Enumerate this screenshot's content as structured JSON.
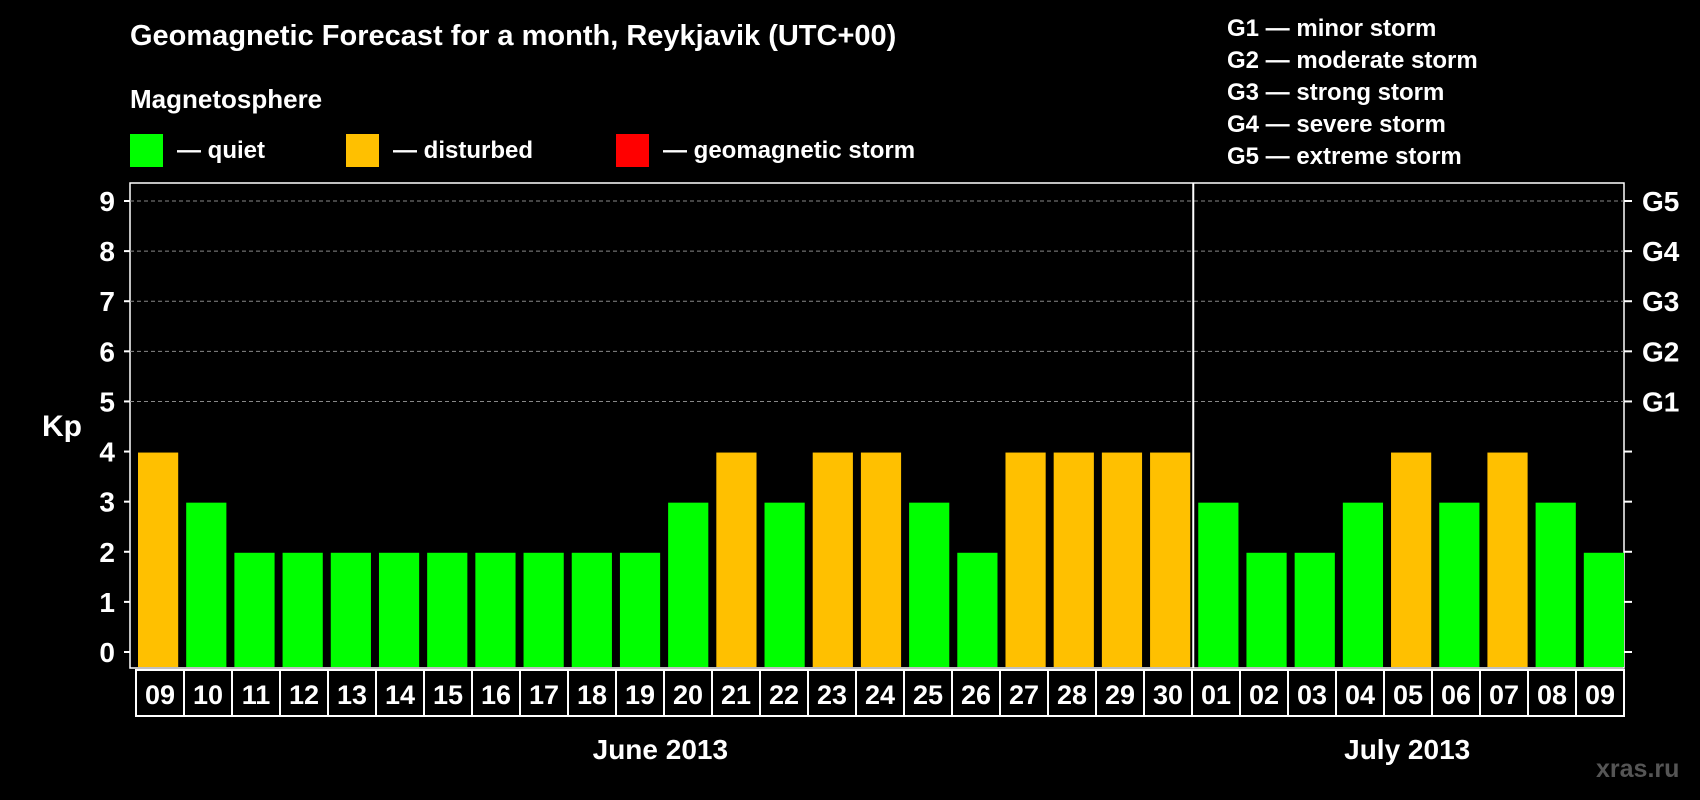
{
  "title": "Geomagnetic Forecast for a month, Reykjavik (UTC+00)",
  "magnetosphere_label": "Magnetosphere",
  "legend": [
    {
      "label": "— quiet",
      "color": "#00ff00"
    },
    {
      "label": "— disturbed",
      "color": "#ffc000"
    },
    {
      "label": "— geomagnetic storm",
      "color": "#ff0000"
    }
  ],
  "storm_levels": [
    "G1 — minor storm",
    "G2 — moderate storm",
    "G3 — strong storm",
    "G4 — severe storm",
    "G5 — extreme storm"
  ],
  "watermark": "xras.ru",
  "chart_data": {
    "type": "bar",
    "ylabel": "Kp",
    "ylim": [
      0,
      9
    ],
    "yticks": [
      "0",
      "1",
      "2",
      "3",
      "4",
      "5",
      "6",
      "7",
      "8",
      "9"
    ],
    "right_axis_labels": [
      {
        "value": 5,
        "label": "G1"
      },
      {
        "value": 6,
        "label": "G2"
      },
      {
        "value": 7,
        "label": "G3"
      },
      {
        "value": 8,
        "label": "G4"
      },
      {
        "value": 9,
        "label": "G5"
      }
    ],
    "categories": [
      "09",
      "10",
      "11",
      "12",
      "13",
      "14",
      "15",
      "16",
      "17",
      "18",
      "19",
      "20",
      "21",
      "22",
      "23",
      "24",
      "25",
      "26",
      "27",
      "28",
      "29",
      "30",
      "01",
      "02",
      "03",
      "04",
      "05",
      "06",
      "07",
      "08",
      "09"
    ],
    "values": [
      4,
      3,
      2,
      2,
      2,
      2,
      2,
      2,
      2,
      2,
      2,
      3,
      4,
      3,
      4,
      4,
      3,
      2,
      4,
      4,
      4,
      4,
      3,
      2,
      2,
      3,
      4,
      3,
      4,
      3,
      2
    ],
    "status": [
      "disturbed",
      "quiet",
      "quiet",
      "quiet",
      "quiet",
      "quiet",
      "quiet",
      "quiet",
      "quiet",
      "quiet",
      "quiet",
      "quiet",
      "disturbed",
      "quiet",
      "disturbed",
      "disturbed",
      "quiet",
      "quiet",
      "disturbed",
      "disturbed",
      "disturbed",
      "disturbed",
      "quiet",
      "quiet",
      "quiet",
      "quiet",
      "disturbed",
      "quiet",
      "disturbed",
      "quiet",
      "quiet"
    ],
    "months": [
      {
        "label": "June 2013",
        "start_index": 0,
        "end_index": 21
      },
      {
        "label": "July 2013",
        "start_index": 22,
        "end_index": 30
      }
    ],
    "grid": "dashed at Kp 5–9",
    "colors": {
      "quiet": "#00ff00",
      "disturbed": "#ffc000",
      "storm": "#ff0000"
    }
  }
}
